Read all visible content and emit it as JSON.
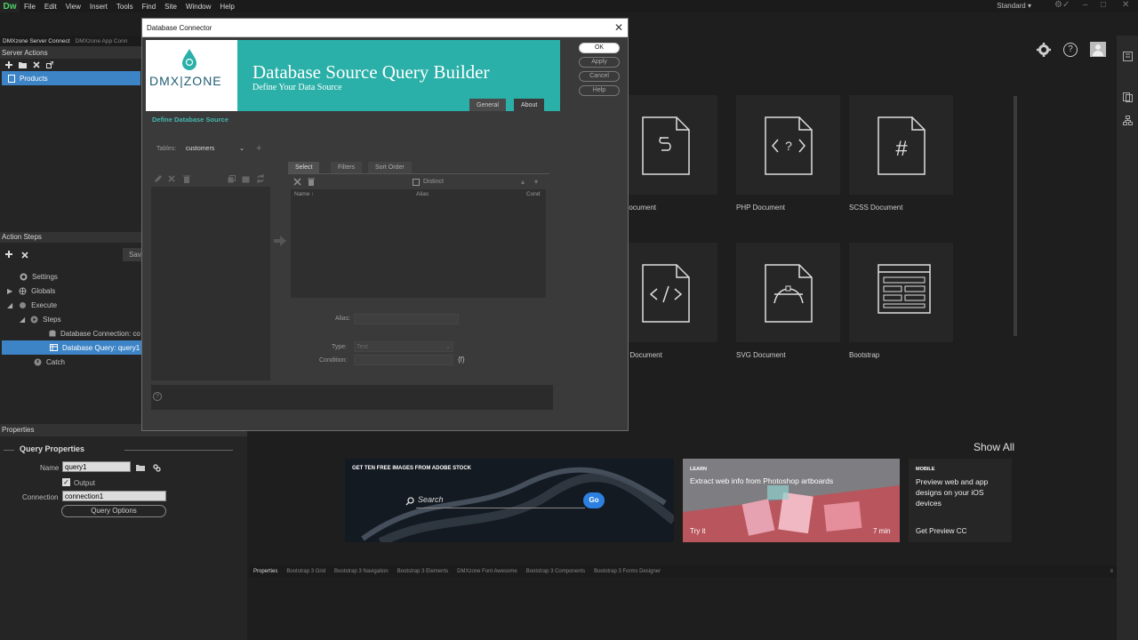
{
  "menubar": {
    "logo": "Dw",
    "items": [
      "File",
      "Edit",
      "View",
      "Insert",
      "Tools",
      "Find",
      "Site",
      "Window",
      "Help"
    ],
    "workspace": "Standard"
  },
  "left_panel": {
    "tabs": [
      "DMXzone Server Connect",
      "DMXzone App Conn"
    ],
    "server_actions_title": "Server Actions",
    "server_actions_items": [
      "Products"
    ],
    "action_steps_title": "Action Steps",
    "save_label": "Sav",
    "steps": [
      {
        "label": "Settings"
      },
      {
        "label": "Globals"
      },
      {
        "label": "Execute"
      },
      {
        "label": "Steps"
      },
      {
        "label": "Database Connection: co"
      },
      {
        "label": "Database Query: query1"
      },
      {
        "label": "Catch"
      }
    ],
    "properties_title": "Properties",
    "query_properties_title": "Query Properties",
    "name_label": "Name",
    "name_value": "query1",
    "output_label": "Output",
    "connection_label": "Connection",
    "connection_value": "connection1",
    "query_options_label": "Query Options"
  },
  "dialog": {
    "title": "Database Connector",
    "logo_text": "DMX|ZONE",
    "banner_title": "Database Source Query Builder",
    "banner_subtitle": "Define Your Data Source",
    "banner_tabs": [
      "General",
      "About"
    ],
    "buttons": {
      "ok": "OK",
      "apply": "Apply",
      "cancel": "Cancel",
      "help": "Help"
    },
    "define_heading": "Define Database Source",
    "tables_label": "Tables:",
    "tables_value": "customers",
    "subtabs": [
      "Select",
      "Filters",
      "Sort Order"
    ],
    "distinct_label": "Distinct",
    "columns": [
      "Name",
      "Alias",
      "Cond"
    ],
    "alias_label": "Alias:",
    "type_label": "Type:",
    "type_value": "Text",
    "condition_label": "Condition:",
    "condition_icon_text": "{f}"
  },
  "main": {
    "cards": [
      {
        "label": "JS Document",
        "icon": "js-file-icon"
      },
      {
        "label": "PHP Document",
        "icon": "php-file-icon"
      },
      {
        "label": "SCSS Document",
        "icon": "scss-file-icon"
      },
      {
        "label": "XML Document",
        "icon": "xml-file-icon"
      },
      {
        "label": "SVG Document",
        "icon": "svg-file-icon"
      },
      {
        "label": "Bootstrap",
        "icon": "bootstrap-layout-icon"
      }
    ],
    "show_all": "Show All",
    "promo_stock": {
      "heading": "GET TEN FREE IMAGES FROM ADOBE STOCK",
      "search": "Search",
      "go": "Go"
    },
    "promo_learn": {
      "tag": "LEARN",
      "title": "Extract web info from Photoshop artboards",
      "link": "Try it",
      "duration": "7 min"
    },
    "promo_mobile": {
      "tag": "MOBILE",
      "title": "Preview web and app designs on your iOS devices",
      "link": "Get Preview CC"
    }
  },
  "bottom_tabs": [
    "Properties",
    "Bootstrap 3 Grid",
    "Bootstrap 3 Navigation",
    "Bootstrap 3 Elements",
    "DMXzone Font Awesome",
    "Bootstrap 3 Components",
    "Bootstrap 3 Forms Designer"
  ]
}
